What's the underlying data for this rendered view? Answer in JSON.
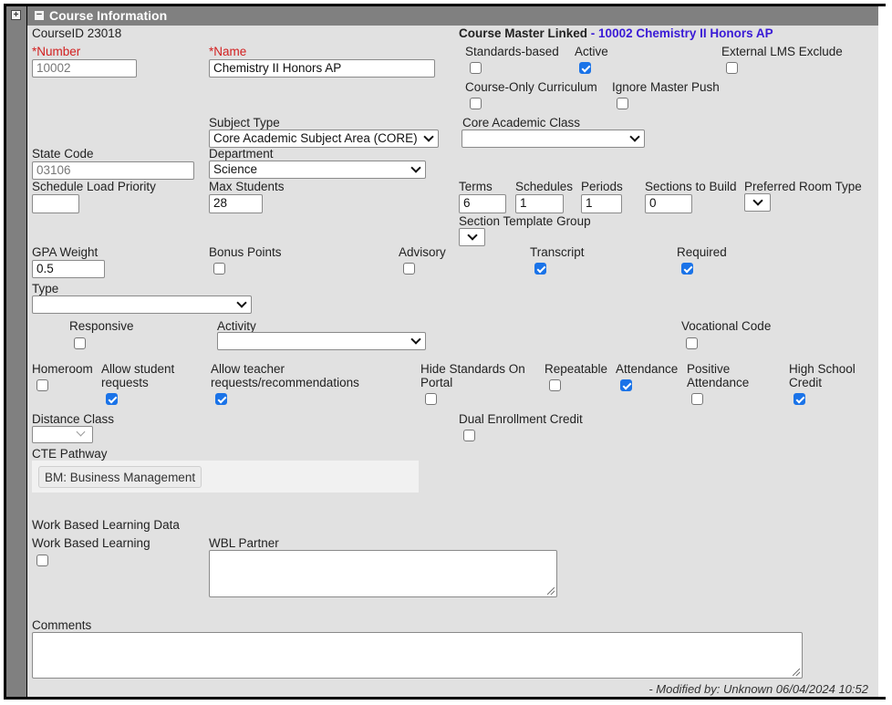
{
  "panel": {
    "title": "Course Information",
    "expand_icon": "plus-square-icon",
    "collapse_icon": "minus-square-icon"
  },
  "course_id": "CourseID 23018",
  "course_master": {
    "label": "Course Master Linked",
    "separator": " - ",
    "link_text": "10002 Chemistry II Honors AP"
  },
  "fields": {
    "number": {
      "label": "*Number",
      "value": "10002"
    },
    "name": {
      "label": "*Name",
      "value": "Chemistry II Honors AP"
    },
    "subject_type": {
      "label": "Subject Type",
      "value": "Core Academic Subject Area (CORE)"
    },
    "core_academic_class": {
      "label": "Core Academic Class",
      "value": ""
    },
    "state_code": {
      "label": "State Code",
      "value": "03106"
    },
    "department": {
      "label": "Department",
      "value": "Science"
    },
    "schedule_load_priority": {
      "label": "Schedule Load Priority",
      "value": ""
    },
    "max_students": {
      "label": "Max Students",
      "value": "28"
    },
    "terms": {
      "label": "Terms",
      "value": "6"
    },
    "schedules": {
      "label": "Schedules",
      "value": "1"
    },
    "periods": {
      "label": "Periods",
      "value": "1"
    },
    "sections_to_build": {
      "label": "Sections to Build",
      "value": "0"
    },
    "preferred_room_type": {
      "label": "Preferred Room Type",
      "value": ""
    },
    "section_template_group": {
      "label": "Section Template Group",
      "value": ""
    },
    "gpa_weight": {
      "label": "GPA Weight",
      "value": "0.5"
    },
    "type": {
      "label": "Type",
      "value": ""
    },
    "activity": {
      "label": "Activity",
      "value": ""
    },
    "distance_class": {
      "label": "Distance Class",
      "value": ""
    },
    "cte_pathway": {
      "label": "CTE Pathway",
      "chip": "BM: Business Management"
    },
    "wbl_section": {
      "label": "Work Based Learning Data"
    },
    "wbl_partner": {
      "label": "WBL Partner",
      "value": ""
    },
    "comments": {
      "label": "Comments",
      "value": ""
    }
  },
  "checkboxes": {
    "standards_based": {
      "label": "Standards-based",
      "checked": false
    },
    "active": {
      "label": "Active",
      "checked": true
    },
    "external_lms_exclude": {
      "label": "External LMS Exclude",
      "checked": false
    },
    "course_only_curriculum": {
      "label": "Course-Only Curriculum",
      "checked": false
    },
    "ignore_master_push": {
      "label": "Ignore Master Push",
      "checked": false
    },
    "bonus_points": {
      "label": "Bonus Points",
      "checked": false
    },
    "advisory": {
      "label": "Advisory",
      "checked": false
    },
    "transcript": {
      "label": "Transcript",
      "checked": true
    },
    "required": {
      "label": "Required",
      "checked": true
    },
    "responsive": {
      "label": "Responsive",
      "checked": false
    },
    "vocational_code": {
      "label": "Vocational Code",
      "checked": false
    },
    "homeroom": {
      "label": "Homeroom",
      "checked": false
    },
    "allow_student_requests": {
      "label_1": "Allow student",
      "label_2": "requests",
      "checked": true
    },
    "allow_teacher_requests": {
      "label_1": "Allow teacher",
      "label_2": "requests/recommendations",
      "checked": true
    },
    "hide_standards_on_portal": {
      "label_1": "Hide Standards On",
      "label_2": "Portal",
      "checked": false
    },
    "repeatable": {
      "label": "Repeatable",
      "checked": false
    },
    "attendance": {
      "label": "Attendance",
      "checked": true
    },
    "positive_attendance": {
      "label_1": "Positive",
      "label_2": "Attendance",
      "checked": false
    },
    "high_school_credit": {
      "label_1": "High School",
      "label_2": "Credit",
      "checked": true
    },
    "dual_enrollment_credit": {
      "label": "Dual Enrollment Credit",
      "checked": false
    },
    "work_based_learning": {
      "label": "Work Based Learning",
      "checked": false
    }
  },
  "footer": {
    "modified": "- Modified by: Unknown 06/04/2024 10:52"
  },
  "colors": {
    "header_bg": "#808080",
    "panel_bg": "#e1e1e1",
    "required_label": "#d21f1f",
    "link": "#3a1bd6",
    "checkbox_checked": "#1a73e8"
  }
}
